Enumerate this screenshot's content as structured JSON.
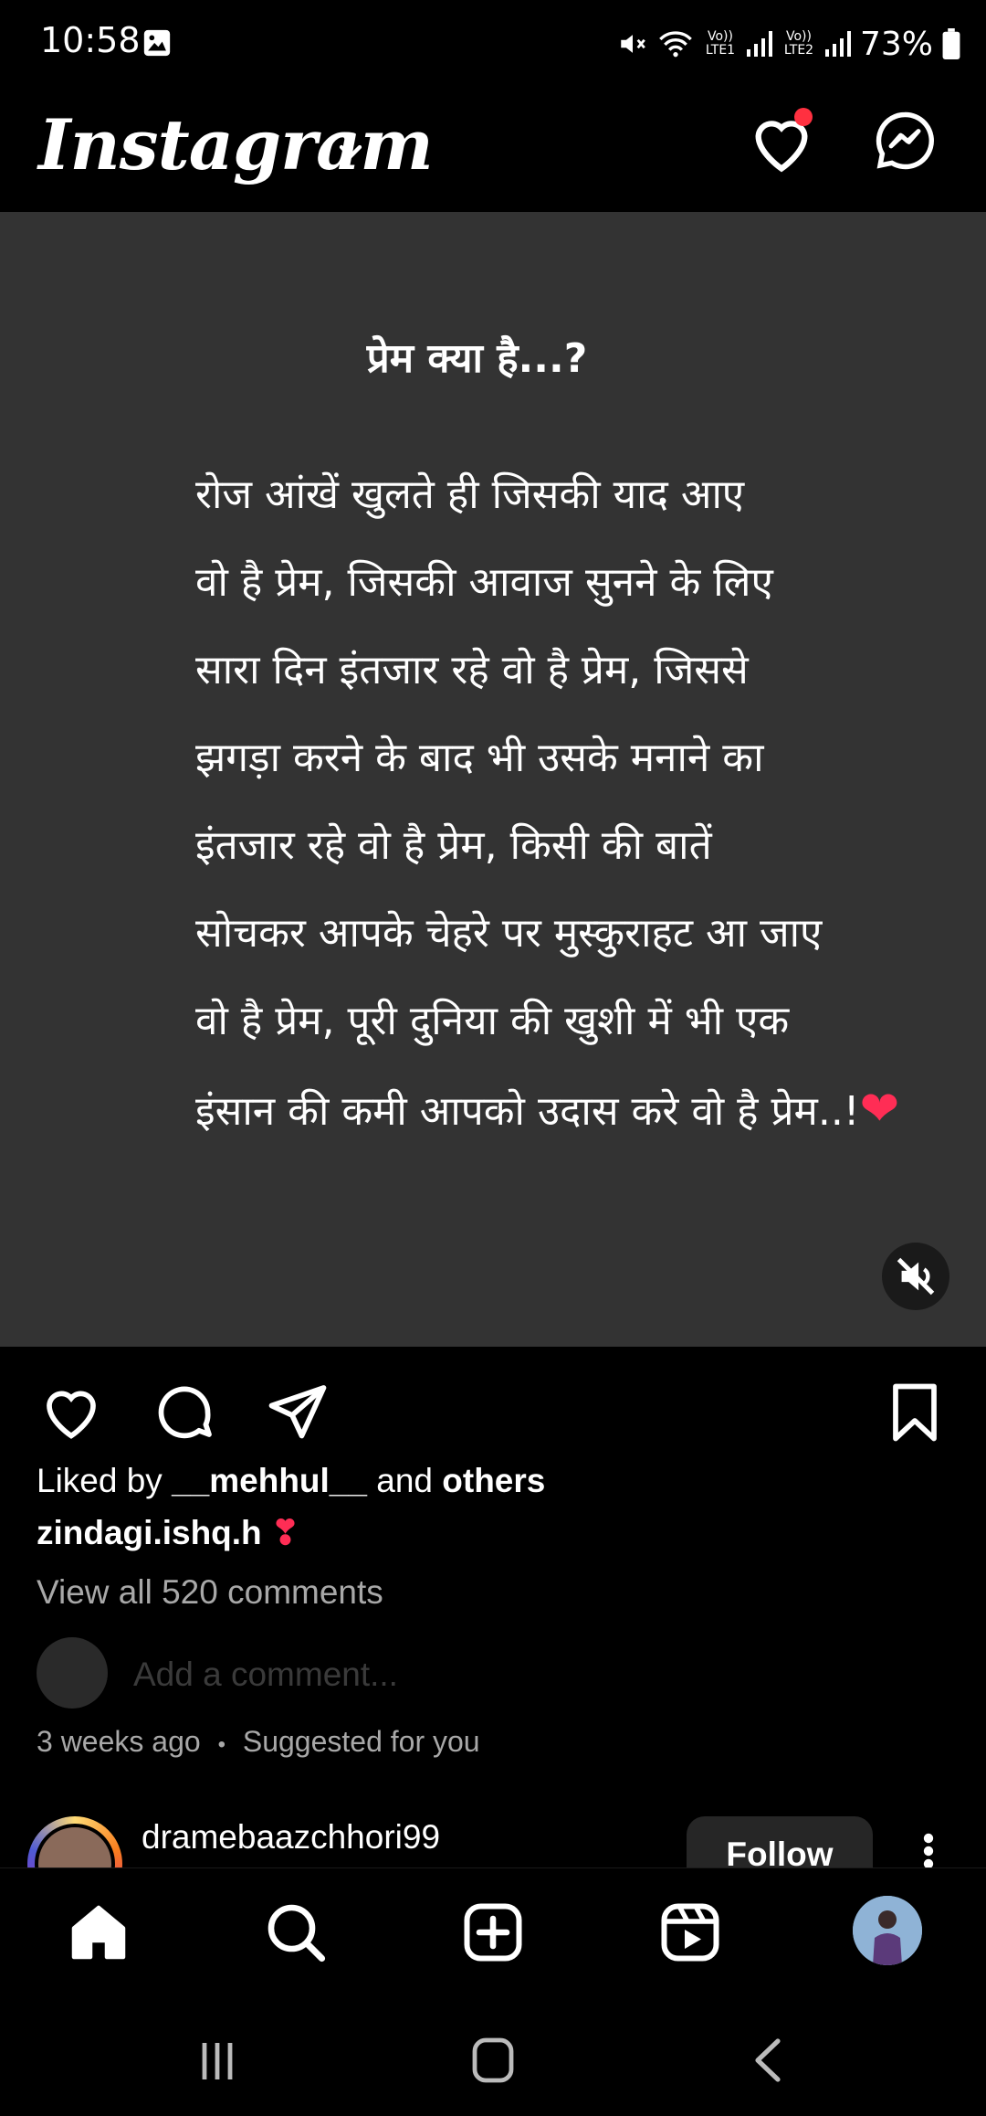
{
  "status_bar": {
    "time": "10:58",
    "network1": "Vo)) LTE1",
    "network2": "Vo)) LTE2",
    "battery": "73%"
  },
  "header": {
    "logo": "Instagram",
    "activity_has_notification": true
  },
  "post": {
    "title": "प्रेम क्या है...?",
    "lines": [
      "रोज आंखें खुलते ही जिसकी याद आए",
      "वो है प्रेम, जिसकी आवाज सुनने के लिए",
      "सारा दिन इंतजार रहे वो है प्रेम, जिससे",
      "झगड़ा करने के बाद भी उसके मनाने का",
      "इंतजार रहे वो है प्रेम, किसी की बातें",
      "सोचकर आपके चेहरे पर मुस्कुराहट आ जाए",
      "वो है प्रेम, पूरी दुनिया की खुशी में भी एक",
      "इंसान की कमी आपको उदास करे वो है प्रेम..!"
    ],
    "heart_emoji": "❤",
    "liked_prefix": "Liked by",
    "liked_user": "__mehhul__",
    "liked_and": "and",
    "liked_others": "others",
    "caption_user": "zindagi.ishq.h",
    "caption_emoji": "❣",
    "view_comments": "View all 520 comments",
    "comment_placeholder": "Add a comment...",
    "time_ago": "3 weeks ago",
    "separator": "•",
    "suggested": "Suggested for you"
  },
  "next_post": {
    "username": "dramebaazchhori99",
    "follow_label": "Follow"
  },
  "colors": {
    "post_bg": "#333333",
    "notification_dot": "#ff3040",
    "heart": "#ff2d55"
  }
}
